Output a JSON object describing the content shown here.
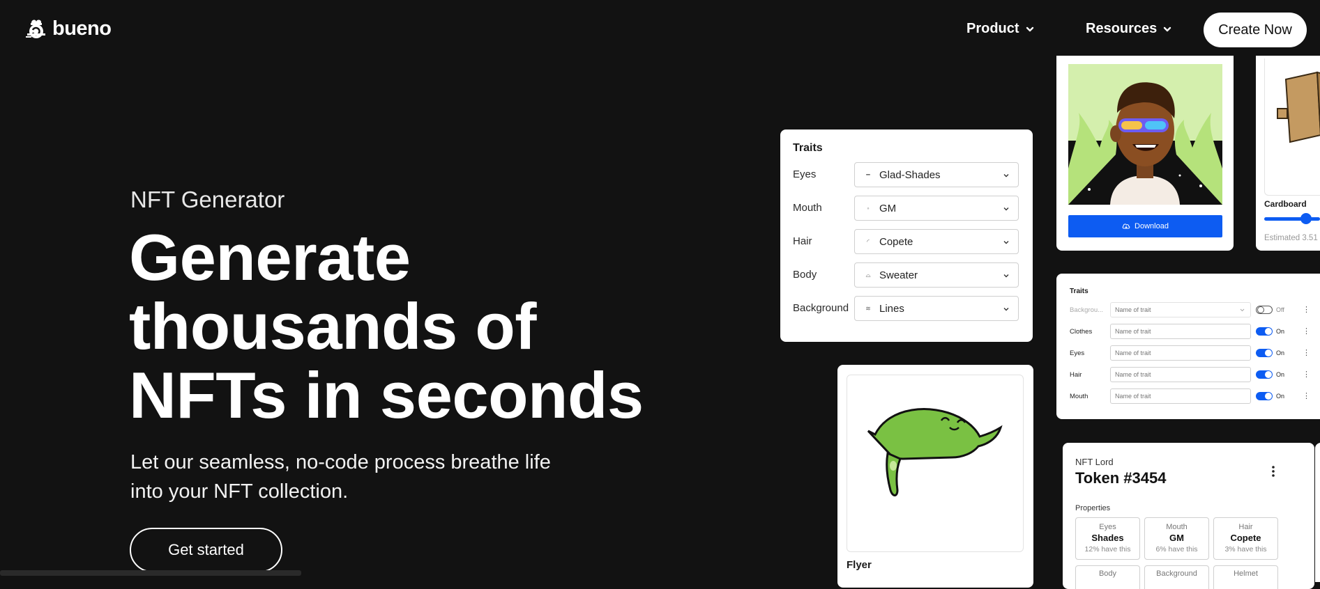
{
  "brand": {
    "name": "bueno",
    "logo_icon": "bueno-chef-logo"
  },
  "nav": {
    "items": [
      {
        "label": "Product",
        "icon": "chevron-down"
      },
      {
        "label": "Resources",
        "icon": "chevron-down"
      }
    ],
    "cta_label": "Create Now"
  },
  "hero": {
    "eyebrow": "NFT Generator",
    "headline_lines": [
      "Generate",
      "thousands of",
      "NFTs in seconds"
    ],
    "subtitle_lines": [
      "Let our seamless, no-code process breathe life",
      "into your NFT collection."
    ],
    "cta_label": "Get started"
  },
  "traits_card": {
    "title": "Traits",
    "rows": [
      {
        "label": "Eyes",
        "value": "Glad-Shades"
      },
      {
        "label": "Mouth",
        "value": "GM"
      },
      {
        "label": "Hair",
        "value": "Copete"
      },
      {
        "label": "Body",
        "value": "Sweater"
      },
      {
        "label": "Background",
        "value": "Lines"
      }
    ]
  },
  "avatar_card": {
    "download_label": "Download",
    "download_icon": "cloud-download"
  },
  "cardboard_card": {
    "label": "Cardboard",
    "estimated": "Estimated 3.51",
    "slider_value": 0.75
  },
  "toggles_card": {
    "title": "Traits",
    "rows": [
      {
        "label": "Backgrou...",
        "placeholder": "Name of trait",
        "state": "Off",
        "on": false,
        "dim": true
      },
      {
        "label": "Clothes",
        "placeholder": "Name of trait",
        "state": "On",
        "on": true,
        "dim": false
      },
      {
        "label": "Eyes",
        "placeholder": "Name of trait",
        "state": "On",
        "on": true,
        "dim": false
      },
      {
        "label": "Hair",
        "placeholder": "Name of trait",
        "state": "On",
        "on": true,
        "dim": false
      },
      {
        "label": "Mouth",
        "placeholder": "Name of trait",
        "state": "On",
        "on": true,
        "dim": false
      }
    ]
  },
  "flyer_card": {
    "label": "Flyer"
  },
  "token_card": {
    "collection": "NFT Lord",
    "name": "Token #3454",
    "properties_label": "Properties",
    "properties": [
      {
        "key": "Eyes",
        "value": "Shades",
        "pct": "12% have this"
      },
      {
        "key": "Mouth",
        "value": "GM",
        "pct": "6% have this"
      },
      {
        "key": "Hair",
        "value": "Copete",
        "pct": "3% have this"
      }
    ],
    "properties_row2": [
      "Body",
      "Background",
      "Helmet"
    ]
  },
  "colors": {
    "background": "#121212",
    "accent": "#0d5cf2",
    "card": "#ffffff"
  }
}
